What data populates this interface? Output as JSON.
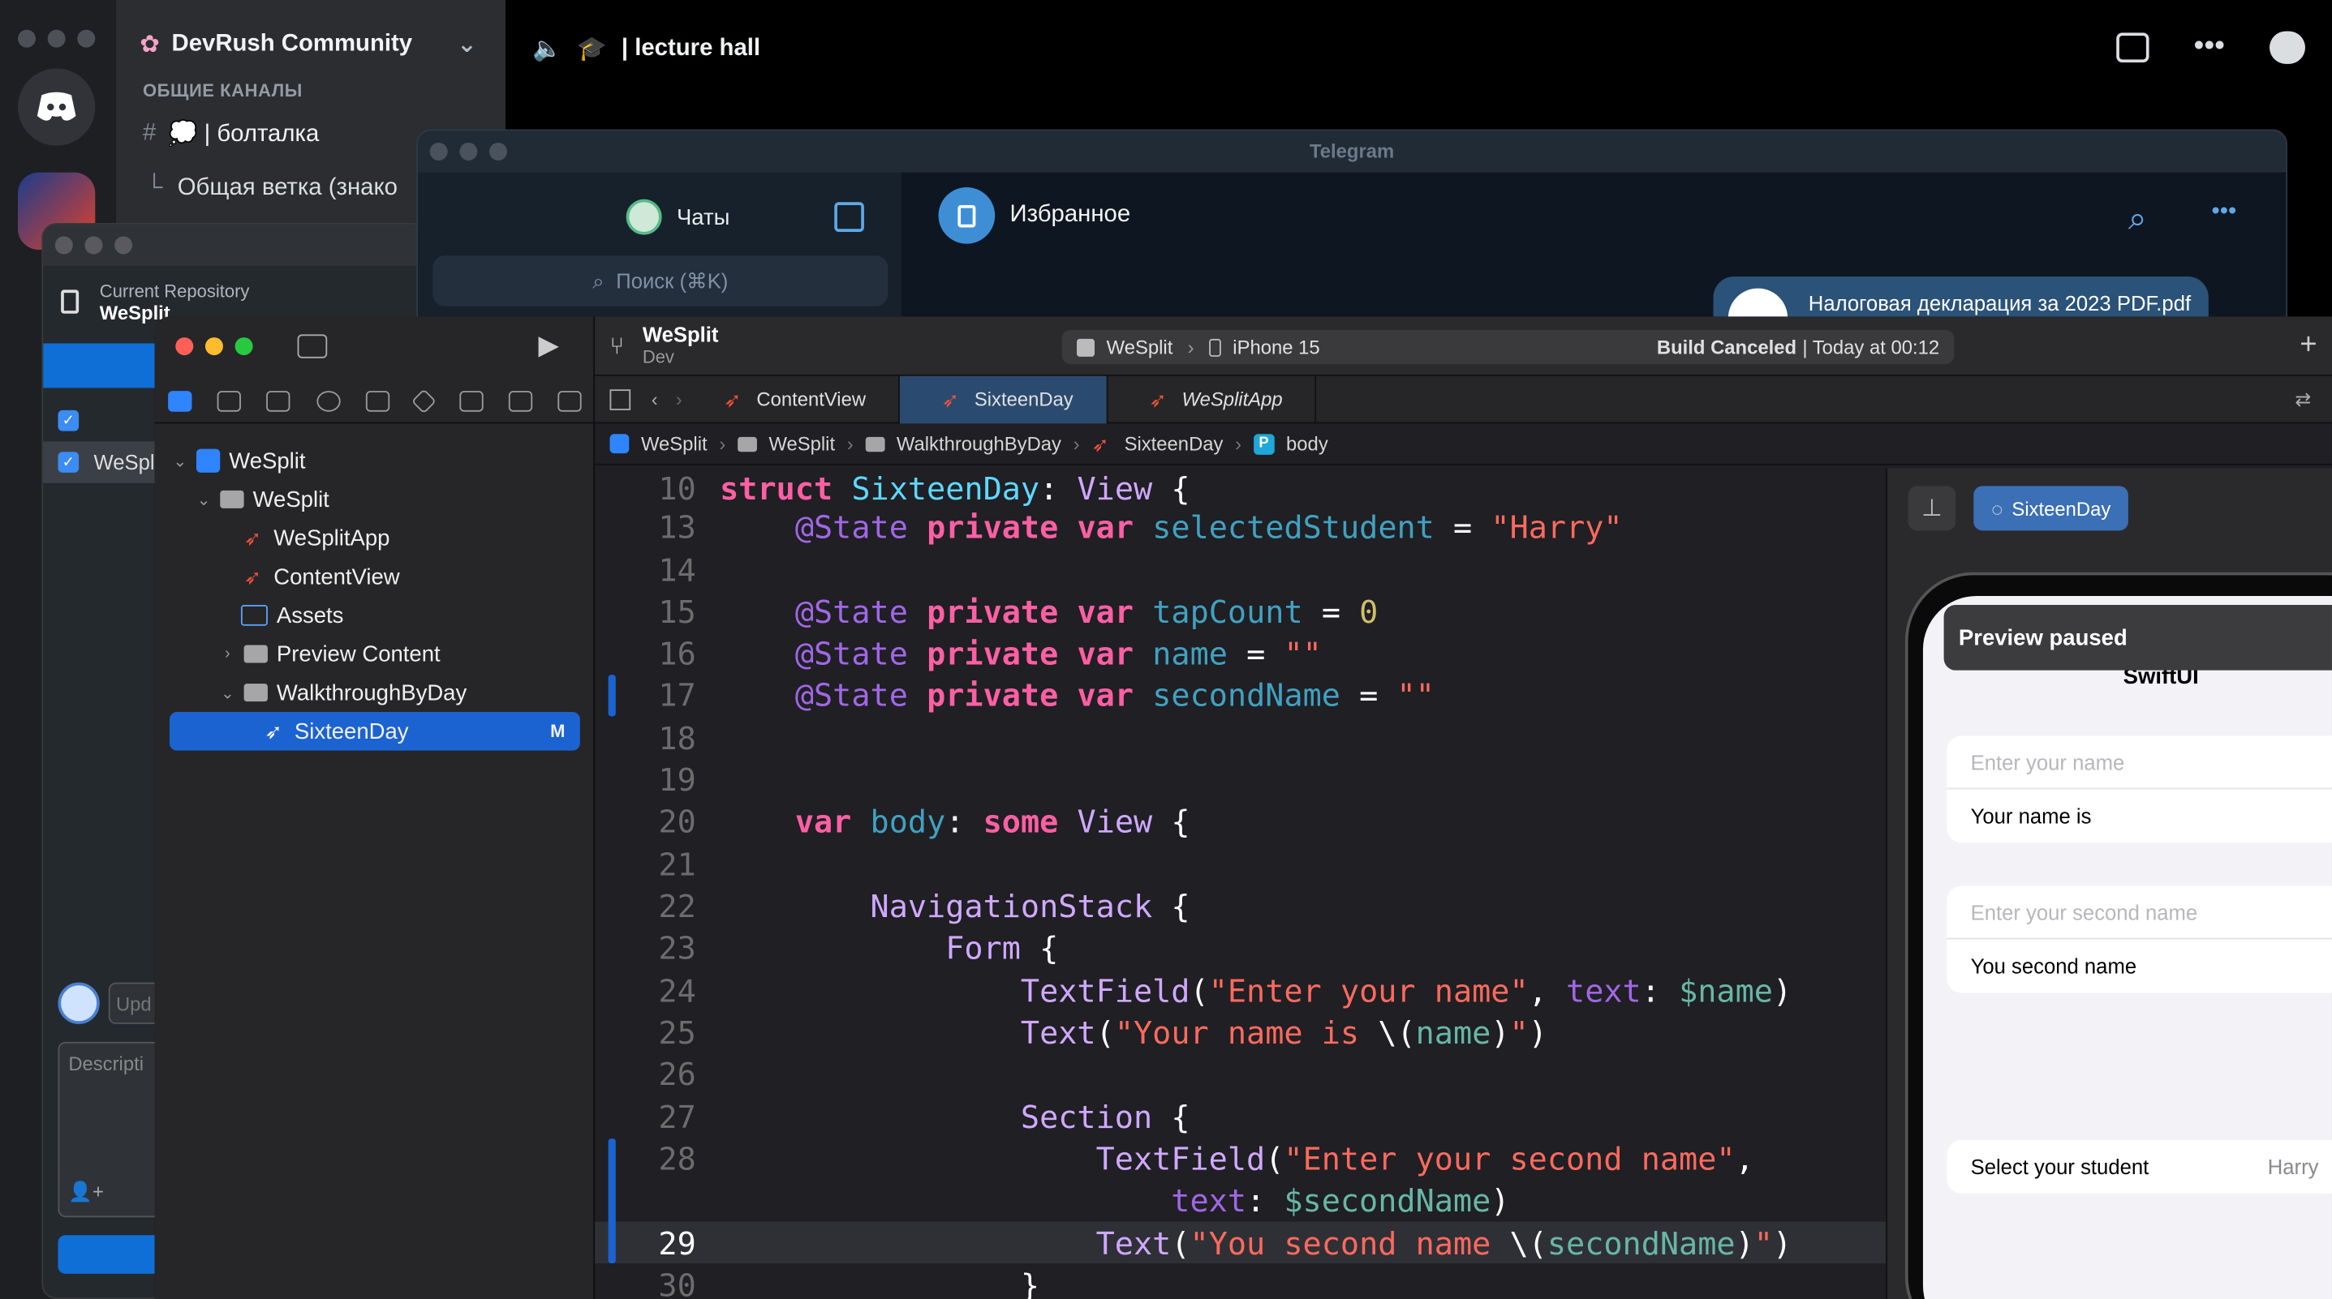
{
  "discord": {
    "server_name": "DevRush Community",
    "category": "ОБЩИЕ КАНАЛЫ",
    "channel": "💭 | болталка",
    "thread": "Общая ветка (знако",
    "header_channel": "| lecture hall"
  },
  "github_desktop": {
    "repo_label": "Current Repository",
    "repo_name": "WeSplit",
    "file_name": "WeSpli",
    "summary_placeholder": "Upd",
    "description_placeholder": "Descripti"
  },
  "telegram": {
    "title": "Telegram",
    "chats_label": "Чаты",
    "search_placeholder": "Поиск (⌘K)",
    "chat_title": "Избранное",
    "file_message": "Налоговая декларация за 2023 PDF.pdf"
  },
  "xcode": {
    "scheme": "WeSplit",
    "branch": "Dev",
    "target": "WeSplit",
    "device": "iPhone 15",
    "status_bold": "Build Canceled",
    "status_time": "| Today at 00:12",
    "tabs": [
      "ContentView",
      "SixteenDay",
      "WeSplitApp"
    ],
    "breadcrumb": [
      "WeSplit",
      "WeSplit",
      "WalkthroughByDay",
      "SixteenDay",
      "body"
    ],
    "tree": {
      "project": "WeSplit",
      "group": "WeSplit",
      "files": [
        "WeSplitApp",
        "ContentView",
        "Assets",
        "Preview Content",
        "WalkthroughByDay",
        "SixteenDay"
      ],
      "badge": "M"
    },
    "line_numbers": [
      "10",
      "13",
      "14",
      "15",
      "16",
      "17",
      "18",
      "19",
      "20",
      "21",
      "22",
      "23",
      "24",
      "25",
      "26",
      "27",
      "28",
      "",
      "29",
      "30"
    ],
    "preview": {
      "tag": "SixteenDay",
      "paused": "Preview paused",
      "nav_title": "SwiftUI",
      "field1_placeholder": "Enter your name",
      "field1_text": "Your name is",
      "field2_placeholder": "Enter your second name",
      "field2_text": "You second name",
      "picker_label": "Select your student",
      "picker_value": "Harry"
    }
  }
}
